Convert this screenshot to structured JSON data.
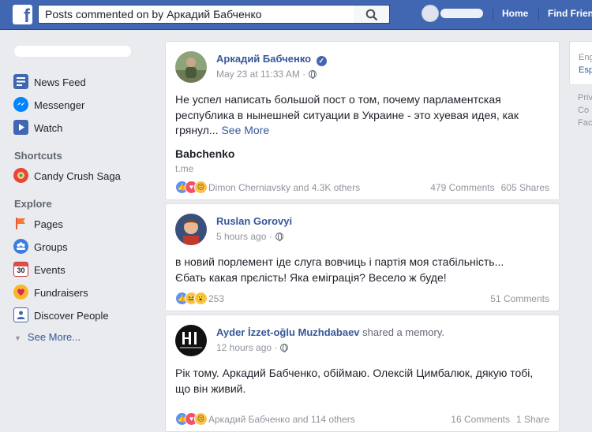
{
  "topbar": {
    "logo": "f",
    "search_query": "Posts commented on by Аркадий Бабченко",
    "nav_links": [
      "Home",
      "Find Friends"
    ]
  },
  "sidebar": {
    "items": [
      {
        "label": "News Feed",
        "icon": "news-feed-icon"
      },
      {
        "label": "Messenger",
        "icon": "messenger-icon"
      },
      {
        "label": "Watch",
        "icon": "watch-icon"
      }
    ],
    "shortcuts_heading": "Shortcuts",
    "shortcuts": [
      {
        "label": "Candy Crush Saga",
        "icon": "candy-crush-icon"
      }
    ],
    "explore_heading": "Explore",
    "explore": [
      {
        "label": "Pages",
        "icon": "pages-flag-icon"
      },
      {
        "label": "Groups",
        "icon": "groups-icon"
      },
      {
        "label": "Events",
        "icon": "calendar-icon",
        "icon_text": "30"
      },
      {
        "label": "Fundraisers",
        "icon": "fundraiser-heart-icon"
      },
      {
        "label": "Discover People",
        "icon": "discover-people-icon"
      }
    ],
    "see_more": "See More..."
  },
  "posts": [
    {
      "author": "Аркадий Бабченко",
      "verified": true,
      "time": "May 23 at 11:33 AM ·",
      "text": "Не успел написать большой пост о том, почему парламентская республика в нынешней ситуации в Украине - это хуевая идея, как грянул...",
      "see_more": "See More",
      "link_title": "Babchenko",
      "link_domain": "t.me",
      "reaction_text": "Dimon Cherniavsky and 4.3K others",
      "comments": "479 Comments",
      "shares": "605 Shares"
    },
    {
      "author": "Ruslan Gorovyi",
      "time": "5 hours ago ·",
      "text": "в новий порлемент іде слуга вовчиць і партія моя стабільність... Єбать какая прєлість! Яка еміграція? Весело ж буде!",
      "reaction_text": "253",
      "comments": "51 Comments"
    },
    {
      "author": "Ayder İzzet-oğlu Muzhdabaev",
      "author_extra": "shared a memory.",
      "time": "12 hours ago ·",
      "text": "Рік тому. Аркадий Бабченко, обіймаю. Олексій Цимбалюк, дякую тобі, що він живий.",
      "reaction_text": "Аркадий Бабченко and 114 others",
      "comments": "16 Comments",
      "shares": "1 Share"
    }
  ],
  "right_col": {
    "box_lines": [
      "Eng",
      "Esp"
    ],
    "footer_lines": [
      "Priv",
      "Co",
      "Fac"
    ]
  },
  "colors": {
    "brand_blue": "#4267b2",
    "link_blue": "#365899",
    "page_bg": "#e9ebee"
  }
}
